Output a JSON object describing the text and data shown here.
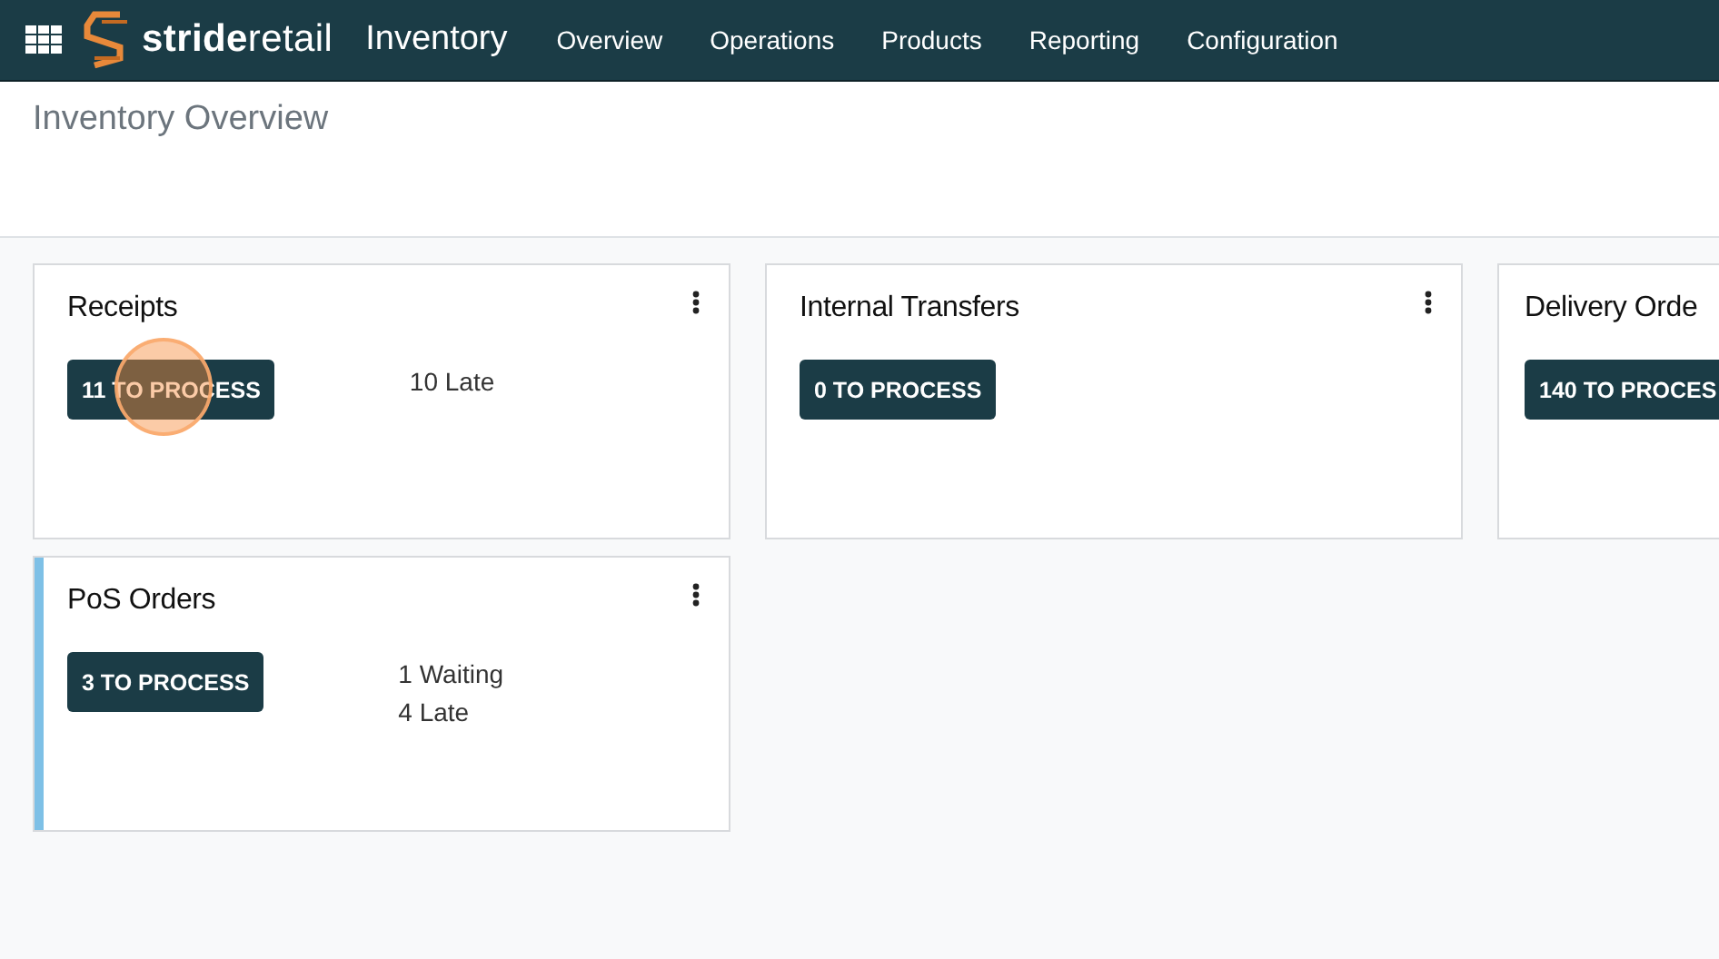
{
  "navbar": {
    "brand": "**stride**retail",
    "app": "Inventory",
    "menu": [
      "Overview",
      "Operations",
      "Products",
      "Reporting",
      "Configuration"
    ]
  },
  "page": {
    "title": "Inventory Overview"
  },
  "cards": [
    {
      "title": "Receipts",
      "button": "11 TO PROCESS",
      "stats": [
        "10 Late"
      ],
      "clicked": true
    },
    {
      "title": "Internal Transfers",
      "button": "0 TO PROCESS",
      "clicked": false
    },
    {
      "title": "Delivery Orde",
      "button": "140 TO PROCES",
      "clicked": false
    },
    {
      "title": "PoS Orders",
      "button": "3 TO PROCESS",
      "stats": [
        "1 Waiting",
        "4 Late"
      ],
      "clicked": false,
      "color": "#7ec0e6"
    }
  ]
}
